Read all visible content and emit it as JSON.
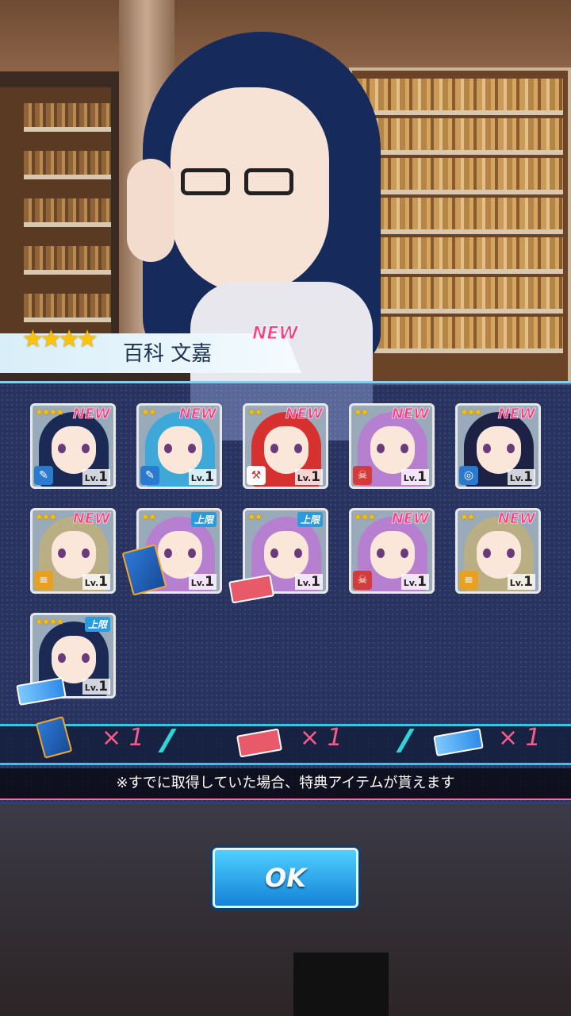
{
  "banner": {
    "rarity": "★★★★",
    "name": "百科 文嘉",
    "badge": "NEW"
  },
  "cards": [
    {
      "stars": "★★★★",
      "badge": "NEW",
      "lv_prefix": "Lv.",
      "lv": "1",
      "hair_color": "#1a2a55",
      "type_color": "#2a7ad0",
      "type_icon": "wrench-icon"
    },
    {
      "stars": "★★",
      "badge": "NEW",
      "lv_prefix": "Lv.",
      "lv": "1",
      "hair_color": "#3ea8d8",
      "type_color": "#2a7ad0",
      "type_icon": "wrench-icon"
    },
    {
      "stars": "★★",
      "badge": "NEW",
      "lv_prefix": "Lv.",
      "lv": "1",
      "hair_color": "#d6302f",
      "type_color": "#ffffff",
      "type_icon": "hammer-icon"
    },
    {
      "stars": "★★",
      "badge": "NEW",
      "lv_prefix": "Lv.",
      "lv": "1",
      "hair_color": "#b77fd0",
      "type_color": "#d43b3b",
      "type_icon": "skull-icon"
    },
    {
      "stars": "★★★",
      "badge": "NEW",
      "lv_prefix": "Lv.",
      "lv": "1",
      "hair_color": "#1d2245",
      "type_color": "#2a7ad0",
      "type_icon": "target-icon"
    },
    {
      "stars": "★★★",
      "badge": "NEW",
      "lv_prefix": "Lv.",
      "lv": "1",
      "hair_color": "#b9ae84",
      "type_color": "#e8a020",
      "type_icon": "bars-icon"
    },
    {
      "stars": "★★",
      "badge": "上限",
      "lv_prefix": "Lv.",
      "lv": "1",
      "hair_color": "#b77fd0",
      "type_color": "none",
      "type_icon": ""
    },
    {
      "stars": "★★",
      "badge": "上限",
      "lv_prefix": "Lv.",
      "lv": "1",
      "hair_color": "#b77fd0",
      "type_color": "none",
      "type_icon": ""
    },
    {
      "stars": "★★★",
      "badge": "NEW",
      "lv_prefix": "Lv.",
      "lv": "1",
      "hair_color": "#b77fd0",
      "type_color": "#d43b3b",
      "type_icon": "skull-icon"
    },
    {
      "stars": "★★",
      "badge": "NEW",
      "lv_prefix": "Lv.",
      "lv": "1",
      "hair_color": "#b9ae84",
      "type_color": "#e8a020",
      "type_icon": "bars-icon"
    },
    {
      "stars": "★★★★",
      "badge": "上限",
      "lv_prefix": "Lv.",
      "lv": "1",
      "hair_color": "#1a2a55",
      "type_color": "none",
      "type_icon": ""
    }
  ],
  "bonus_items": [
    {
      "icon": "blue-book-icon",
      "count": "× 1"
    },
    {
      "icon": "red-ticket-icon",
      "count": "× 1"
    },
    {
      "icon": "blue-ticket-icon",
      "count": "× 1"
    }
  ],
  "notice": "※すでに取得していた場合、特典アイテムが貰えます",
  "ok_label": "OK"
}
